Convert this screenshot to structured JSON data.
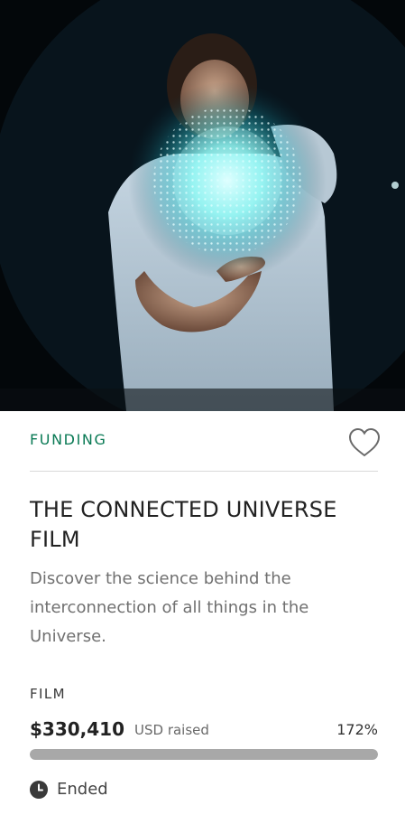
{
  "campaign": {
    "category": "FUNDING",
    "title": "THE CONNECTED UNIVERSE FILM",
    "description": "Discover the science behind the interconnection of all things in the Universe.",
    "tag": "FILM",
    "amount_raised": "$330,410",
    "currency_label": "USD raised",
    "percent_funded": "172%",
    "progress_fraction": 1.0,
    "status": "Ended"
  },
  "icons": {
    "favorite": "heart-outline-icon",
    "status": "clock-icon"
  },
  "colors": {
    "category": "#0a7a55",
    "progress_fill": "#a8a8a8",
    "progress_track": "#e6e6e6",
    "text_primary": "#222222",
    "text_secondary": "#707070"
  }
}
